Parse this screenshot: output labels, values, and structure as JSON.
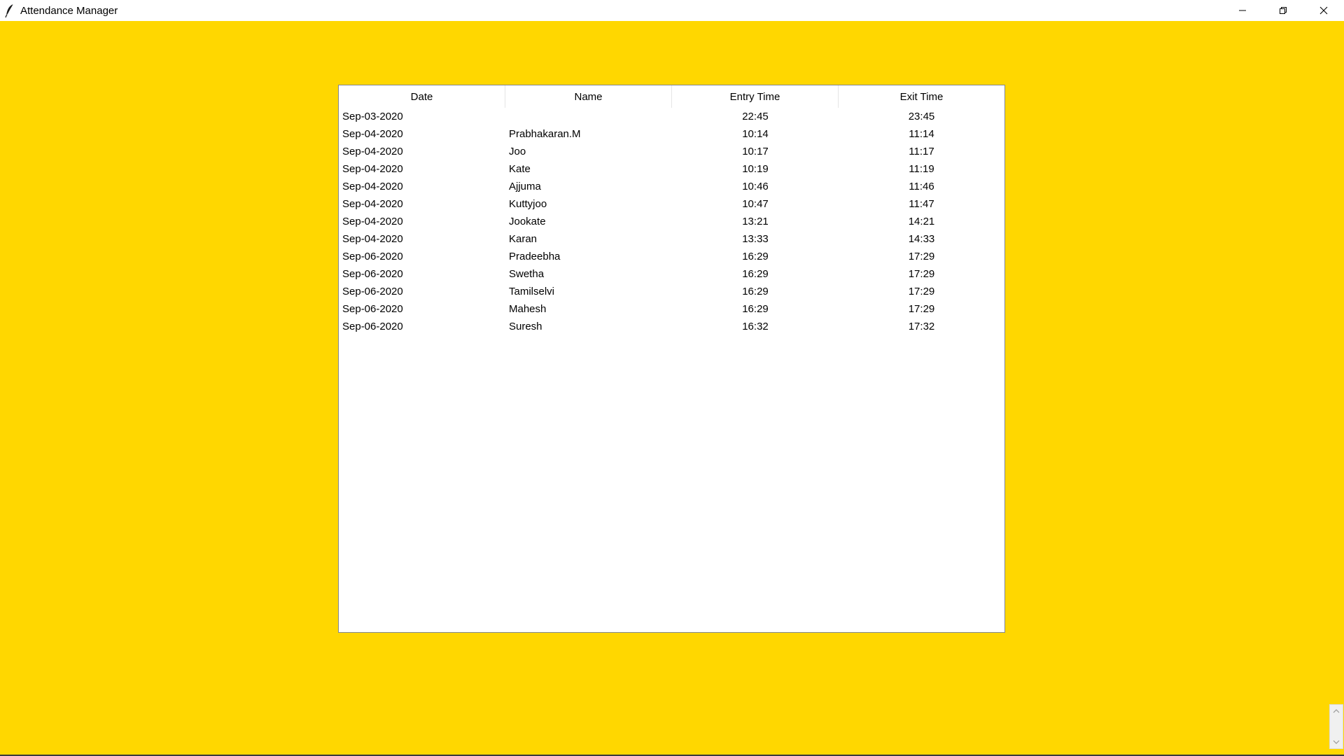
{
  "window": {
    "title": "Attendance Manager",
    "icon": "feather-icon",
    "background_color": "#ffd700"
  },
  "table": {
    "columns": [
      "Date",
      "Name",
      "Entry Time",
      "Exit Time"
    ],
    "rows": [
      {
        "date": "Sep-03-2020",
        "name": "",
        "entry": "22:45",
        "exit": "23:45"
      },
      {
        "date": "Sep-04-2020",
        "name": "Prabhakaran.M",
        "entry": "10:14",
        "exit": "11:14"
      },
      {
        "date": "Sep-04-2020",
        "name": "Joo",
        "entry": "10:17",
        "exit": "11:17"
      },
      {
        "date": "Sep-04-2020",
        "name": "Kate",
        "entry": "10:19",
        "exit": "11:19"
      },
      {
        "date": "Sep-04-2020",
        "name": "Ajjuma",
        "entry": "10:46",
        "exit": "11:46"
      },
      {
        "date": "Sep-04-2020",
        "name": "Kuttyjoo",
        "entry": "10:47",
        "exit": "11:47"
      },
      {
        "date": "Sep-04-2020",
        "name": "Jookate",
        "entry": "13:21",
        "exit": "14:21"
      },
      {
        "date": "Sep-04-2020",
        "name": "Karan",
        "entry": "13:33",
        "exit": "14:33"
      },
      {
        "date": "Sep-06-2020",
        "name": "Pradeebha",
        "entry": "16:29",
        "exit": "17:29"
      },
      {
        "date": "Sep-06-2020",
        "name": "Swetha",
        "entry": "16:29",
        "exit": "17:29"
      },
      {
        "date": "Sep-06-2020",
        "name": "Tamilselvi",
        "entry": "16:29",
        "exit": "17:29"
      },
      {
        "date": "Sep-06-2020",
        "name": "Mahesh",
        "entry": "16:29",
        "exit": "17:29"
      },
      {
        "date": "Sep-06-2020",
        "name": "Suresh",
        "entry": "16:32",
        "exit": "17:32"
      }
    ]
  }
}
